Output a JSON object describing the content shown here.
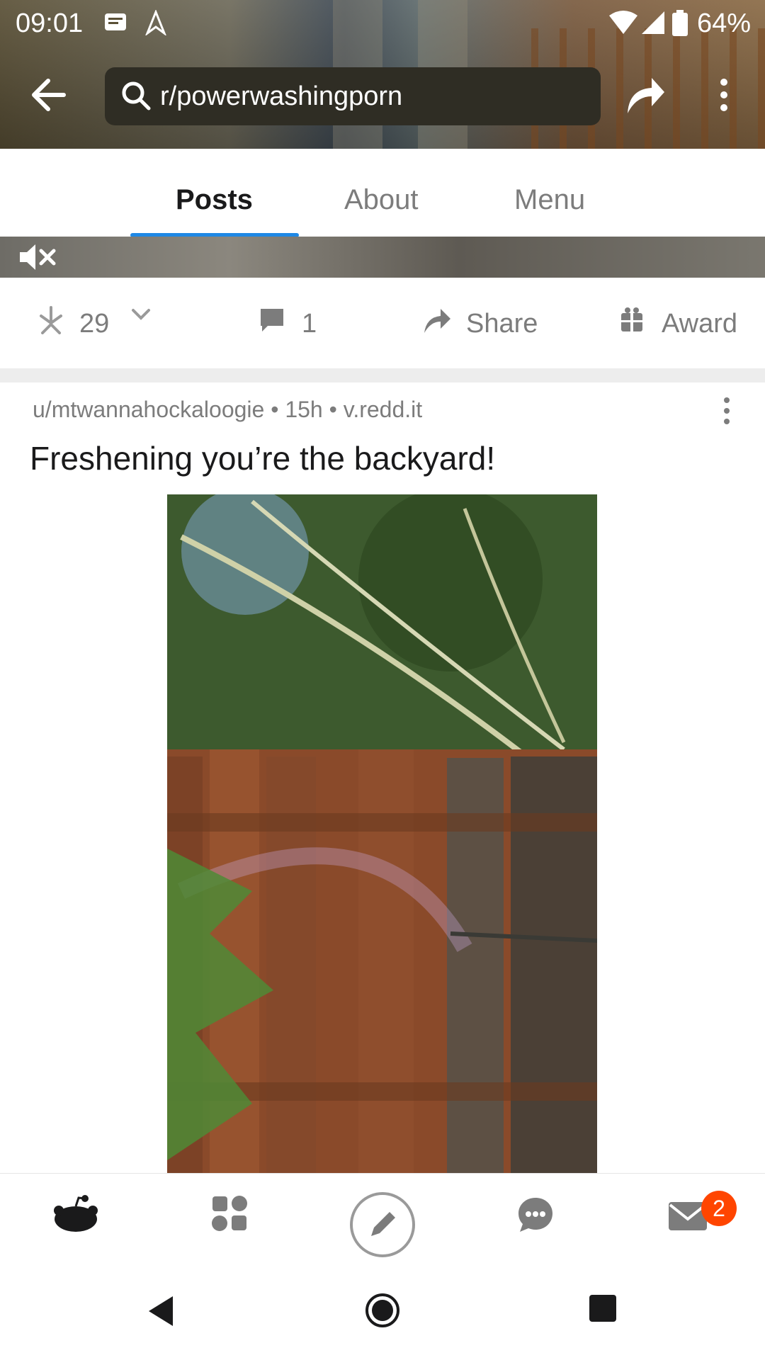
{
  "status_bar": {
    "time": "09:01",
    "battery": "64%"
  },
  "header": {
    "search_text": "r/powerwashingporn"
  },
  "tabs": [
    {
      "label": "Posts",
      "active": true
    },
    {
      "label": "About",
      "active": false
    },
    {
      "label": "Menu",
      "active": false
    }
  ],
  "prev_post_actions": {
    "votes": "29",
    "comments": "1",
    "share_label": "Share",
    "award_label": "Award"
  },
  "post": {
    "meta": "u/mtwannahockaloogie • 15h • v.redd.it",
    "title": "Freshening you’re the backyard!"
  },
  "bottom_nav": {
    "inbox_badge": "2"
  },
  "colors": {
    "accent_tab": "#1e88e5",
    "badge": "#ff4500",
    "text_primary": "#1a1a1b",
    "text_secondary": "#7c7c7c"
  }
}
